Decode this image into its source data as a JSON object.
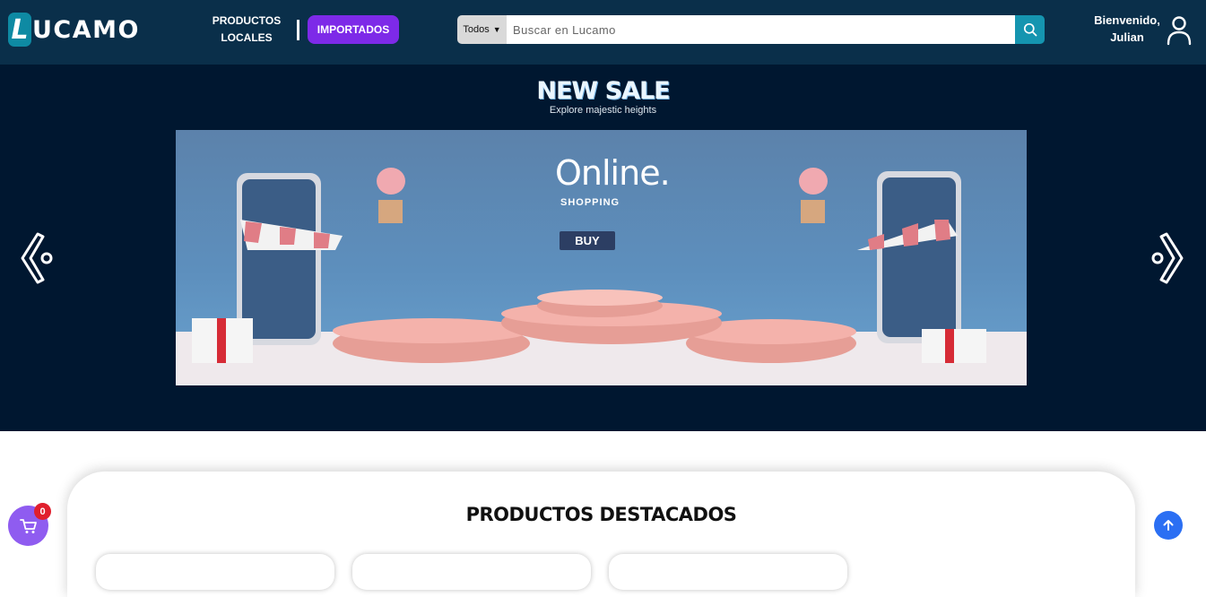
{
  "header": {
    "logo_first": "L",
    "logo_rest": "UCAMO",
    "nav_local_line1": "PRODUCTOS",
    "nav_local_line2": "LOCALES",
    "nav_imported": "IMPORTADOS",
    "search": {
      "category": "Todos",
      "placeholder": "Buscar en Lucamo"
    },
    "welcome_line1": "Bienvenido,",
    "welcome_line2": "Julian"
  },
  "hero": {
    "title": "NEW SALE",
    "subtitle": "Explore majestic heights",
    "banner": {
      "online_text": "Online.",
      "shopping_text": "SHOPPING",
      "buy_label": "BUY"
    }
  },
  "featured": {
    "title": "PRODUCTOS DESTACADOS"
  },
  "cart": {
    "count": "0"
  },
  "colors": {
    "header_bg": "#0a2f4a",
    "hero_bg": "#001730",
    "accent_purple": "#7d2ae8",
    "search_button": "#1595b0",
    "cart_fab": "#8f5cf0",
    "badge_red": "#e01f2d",
    "scroll_top_blue": "#2b6ff3"
  },
  "icons": {
    "search": "search-icon",
    "user": "user-icon",
    "prev": "chevron-left-icon",
    "next": "chevron-right-icon",
    "cart": "cart-icon",
    "up": "arrow-up-icon"
  }
}
